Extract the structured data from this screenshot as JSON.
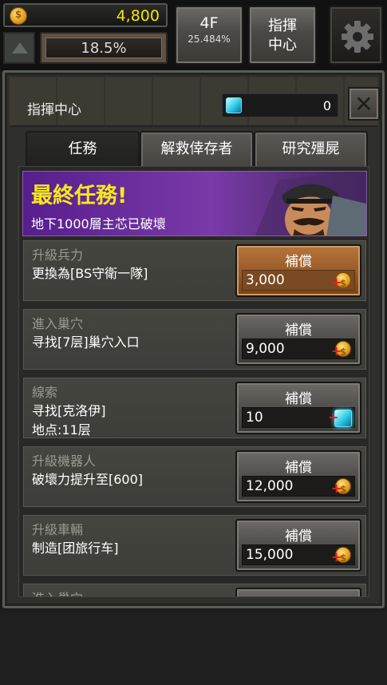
{
  "hud": {
    "gold": "4,800",
    "progress_percent": "18.5%",
    "floor": "4F",
    "floor_percent": "25.484%",
    "command_line1": "指揮",
    "command_line2": "中心",
    "icons": {
      "gold": "coin-icon",
      "up": "arrow-up-icon",
      "settings": "gear-icon"
    }
  },
  "panel": {
    "title": "指揮中心",
    "gems": "0",
    "close_label": "✕",
    "tabs": [
      {
        "label": "任務",
        "active": true
      },
      {
        "label": "解救倖存者",
        "active": false
      },
      {
        "label": "研究殭屍",
        "active": false
      }
    ]
  },
  "banner": {
    "title": "最終任務!",
    "subtitle": "地下1000層主芯已破壞"
  },
  "quests": [
    {
      "category": "升級兵力",
      "desc": "更換為[BS守衛一隊]",
      "reward_label": "補償",
      "reward_value": "3,000",
      "reward_type": "coin",
      "highlight": true
    },
    {
      "category": "進入巢穴",
      "desc": "寻找[7层]巢穴入口",
      "reward_label": "補償",
      "reward_value": "9,000",
      "reward_type": "coin",
      "highlight": false
    },
    {
      "category": "線索",
      "desc": "寻找[克洛伊]",
      "desc2": "地点:11层",
      "reward_label": "補償",
      "reward_value": "10",
      "reward_type": "gem",
      "highlight": false
    },
    {
      "category": "升級機器人",
      "desc": "破壞力提升至[600]",
      "reward_label": "補償",
      "reward_value": "12,000",
      "reward_type": "coin",
      "highlight": false
    },
    {
      "category": "升級車輛",
      "desc": "制造[团旅行车]",
      "reward_label": "補償",
      "reward_value": "15,000",
      "reward_type": "coin",
      "highlight": false
    },
    {
      "category": "進入巢穴",
      "desc": "",
      "reward_label": "補償",
      "reward_value": "",
      "reward_type": "coin",
      "highlight": false
    }
  ],
  "colors": {
    "gold_text": "#f3e600",
    "banner_bg": "#6a2fa0",
    "reward_highlight": "#a0612b"
  }
}
